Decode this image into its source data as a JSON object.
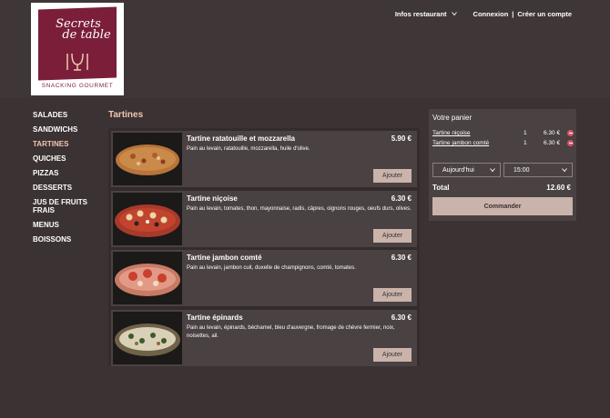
{
  "brand": {
    "title_line1": "Secrets",
    "title_line2": "de table",
    "subtitle": "SNACKING GOURMET",
    "color": "#7a1e3a"
  },
  "topnav": {
    "info": "Infos restaurant",
    "login": "Connexion",
    "separator": "|",
    "register": "Créer un compte"
  },
  "sidebar": {
    "items": [
      {
        "label": "SALADES"
      },
      {
        "label": "SANDWICHS"
      },
      {
        "label": "TARTINES",
        "active": true
      },
      {
        "label": "QUICHES"
      },
      {
        "label": "PIZZAS"
      },
      {
        "label": "DESSERTS"
      },
      {
        "label": "JUS DE FRUITS FRAIS"
      },
      {
        "label": "MENUS"
      },
      {
        "label": "BOISSONS"
      }
    ]
  },
  "main": {
    "section_title": "Tartines",
    "add_label": "Ajouter",
    "products": [
      {
        "name": "Tartine ratatouille et mozzarella",
        "price": "5.90 €",
        "description": "Pain au levain, ratatouille, mozzarella, huile d'olive."
      },
      {
        "name": "Tartine niçoise",
        "price": "6.30 €",
        "description": "Pain au levain, tomates, thon, mayonnaise, radis, câpres, oignons rouges, oeufs durs, olives."
      },
      {
        "name": "Tartine jambon comté",
        "price": "6.30 €",
        "description": "Pain au levain, jambon cuit, duxelle de champignons, comté, tomates."
      },
      {
        "name": "Tartine épinards",
        "price": "6.30 €",
        "description": "Pain au levain, épinards, béchamel, bleu d'auvergne, fromage de chèvre fermier, noix, noisettes, ail."
      }
    ]
  },
  "cart": {
    "title": "Votre panier",
    "items": [
      {
        "name": "Tartine niçoise",
        "qty": "1",
        "price": "6.30 €"
      },
      {
        "name": "Tartine jambon comté",
        "qty": "1",
        "price": "6.30 €"
      }
    ],
    "day": "Aujourd'hui",
    "time": "15:00",
    "total_label": "Total",
    "total_value": "12.60 €",
    "order_label": "Commander"
  },
  "colors": {
    "background": "#3a3233",
    "panel": "#4a4142",
    "accent": "#f2c6b0",
    "button": "#c9b3aa",
    "remove": "#d9556a"
  }
}
